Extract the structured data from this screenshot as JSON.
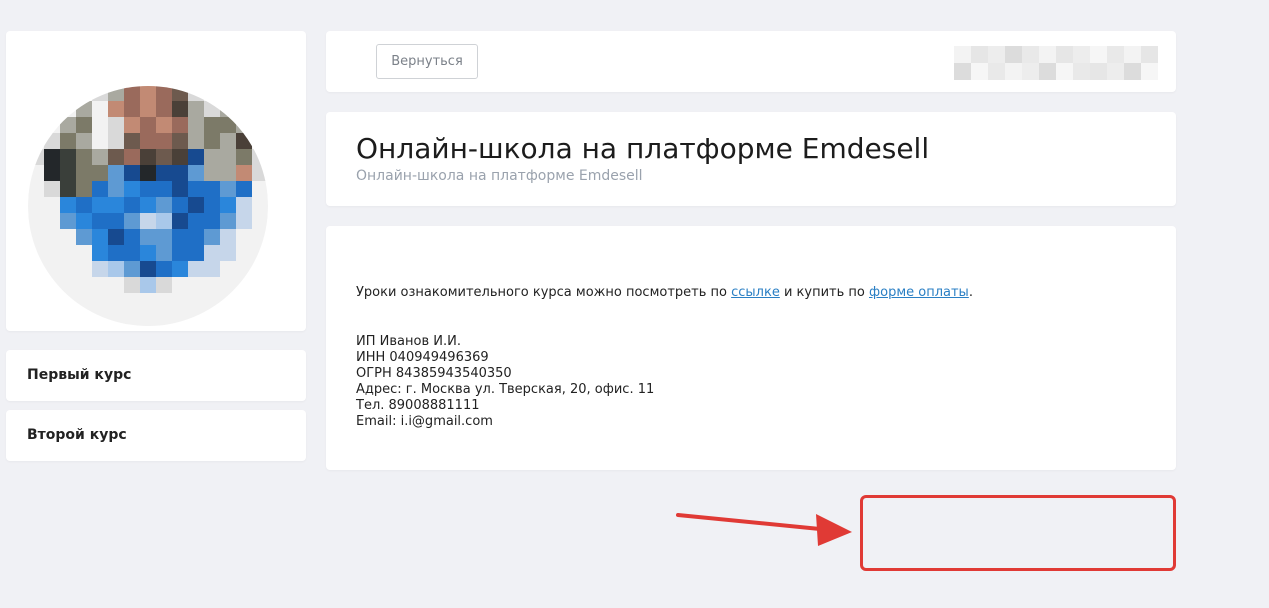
{
  "profile": {
    "avatar_icon": "blurred-profile-photo"
  },
  "sidebar": {
    "courses": [
      {
        "label": "Первый курс"
      },
      {
        "label": "Второй курс"
      }
    ]
  },
  "topbar": {
    "back_label": "Вернуться",
    "user_name_icon": "blurred-user-name"
  },
  "school": {
    "title": "Онлайн-школа на платформе Emdesell",
    "subtitle": "Онлайн-школа на платформе Emdesell"
  },
  "content": {
    "intro_before_link1": "Уроки ознакомительного курса можно посмотреть по ",
    "link1_text": "ссылке",
    "intro_between": " и купить по ",
    "link2_text": "форме оплаты",
    "intro_end": ".",
    "contacts": [
      "ИП Иванов И.И.",
      "ИНН 040949496369",
      "ОГРН 84385943540350",
      "Адрес: г. Москва ул. Тверская, 20, офис. 11",
      "Тел. 89008881111",
      "Email: i.i@gmail.com"
    ]
  },
  "annotation": {
    "highlight_color": "#e03a35",
    "arrow_color": "#e03a35"
  },
  "colors": {
    "background": "#f0f1f5",
    "card": "#ffffff",
    "link": "#2a7fc4",
    "muted": "#9aa2ad"
  }
}
